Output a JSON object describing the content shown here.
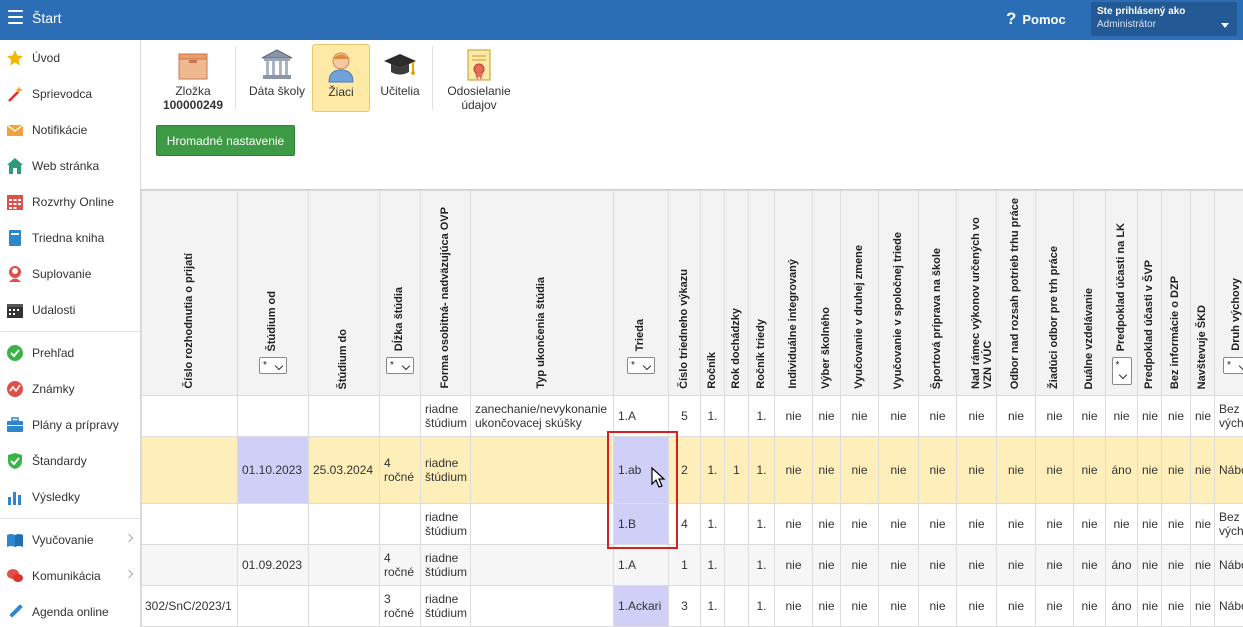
{
  "app": {
    "title": "Štart",
    "help": "Pomoc",
    "user_line1": "Ste prihlásený ako",
    "user_line2": "Administrátor"
  },
  "sidebar": {
    "items": [
      {
        "label": "Úvod",
        "icon": "star-icon"
      },
      {
        "label": "Sprievodca",
        "icon": "wand-icon"
      },
      {
        "label": "Notifikácie",
        "icon": "envelope-icon"
      },
      {
        "label": "Web stránka",
        "icon": "house-icon"
      },
      {
        "label": "Rozvrhy Online",
        "icon": "calendar-grid-icon"
      },
      {
        "label": "Triedna kniha",
        "icon": "book-icon"
      },
      {
        "label": "Suplovanie",
        "icon": "person-icon"
      },
      {
        "label": "Udalosti",
        "icon": "calendar-icon"
      },
      {
        "label": "Prehľad",
        "icon": "check-circle-icon"
      },
      {
        "label": "Známky",
        "icon": "graph-circle-icon"
      },
      {
        "label": "Plány a prípravy",
        "icon": "briefcase-icon"
      },
      {
        "label": "Štandardy",
        "icon": "shield-icon"
      },
      {
        "label": "Výsledky",
        "icon": "bar-chart-icon"
      },
      {
        "label": "Vyučovanie",
        "icon": "open-book-icon"
      },
      {
        "label": "Komunikácia",
        "icon": "chat-icon"
      },
      {
        "label": "Agenda online",
        "icon": "pencil-icon"
      }
    ]
  },
  "toolbar": {
    "folder_label": "Zložka",
    "folder_number": "100000249",
    "school_data": "Dáta školy",
    "students": "Žiaci",
    "teachers": "Učitelia",
    "send_line1": "Odosielanie",
    "send_line2": "údajov"
  },
  "bulk_button": "Hromadné nastavenie",
  "columns": [
    "Číslo rozhodnutia o prijatí",
    "Štúdium od",
    "Štúdium do",
    "Dĺžka štúdia",
    "Forma osobitná- nadväzujúca OVP",
    "Typ ukončenia štúdia",
    "Trieda",
    "Číslo triedneho výkazu",
    "Ročník",
    "Rok dochádzky",
    "Ročník triedy",
    "Individuálne integrovaný",
    "Výber školného",
    "Vyučovanie v druhej zmene",
    "Vyučovanie v spoločnej triede",
    "Športová príprava na škole",
    "Nad rámec výkonov určených vo VZN VÚC",
    "Odbor nad rozsah potrieb trhu práce",
    "Žiadúci odbor pre trh práce",
    "Duálne vzdelávanie",
    "Predpoklad účasti na LK",
    "Predpoklad účasti v ŠVP",
    "Bez informácie o DZP",
    "Navštevuje ŠKD",
    "Druh výchovy"
  ],
  "filter_value": "*",
  "rows": [
    [
      "",
      "",
      "",
      "",
      "riadne štúdium",
      "zanechanie/nevykonanie ukončovacej skúšky",
      "1.A",
      "5",
      "1.",
      "",
      "1.",
      "nie",
      "nie",
      "nie",
      "nie",
      "nie",
      "nie",
      "nie",
      "nie",
      "nie",
      "nie",
      "nie",
      "nie",
      "nie",
      "Bez výchovy"
    ],
    [
      "",
      "01.10.2023",
      "25.03.2024",
      "4 ročné",
      "riadne štúdium",
      "",
      "1.ab",
      "2",
      "1.",
      "1",
      "1.",
      "nie",
      "nie",
      "nie",
      "nie",
      "nie",
      "nie",
      "nie",
      "nie",
      "nie",
      "áno",
      "nie",
      "nie",
      "nie",
      "Nábože"
    ],
    [
      "",
      "",
      "",
      "",
      "riadne štúdium",
      "",
      "1.B",
      "4",
      "1.",
      "",
      "1.",
      "nie",
      "nie",
      "nie",
      "nie",
      "nie",
      "nie",
      "nie",
      "nie",
      "nie",
      "nie",
      "nie",
      "nie",
      "nie",
      "Bez výchovy"
    ],
    [
      "",
      "01.09.2023",
      "",
      "4 ročné",
      "riadne štúdium",
      "",
      "1.A",
      "1",
      "1.",
      "",
      "1.",
      "nie",
      "nie",
      "nie",
      "nie",
      "nie",
      "nie",
      "nie",
      "nie",
      "nie",
      "áno",
      "nie",
      "nie",
      "nie",
      "Nábože"
    ],
    [
      "302/SnC/2023/1",
      "",
      "",
      "3 ročné",
      "riadne štúdium",
      "",
      "1.Ackari",
      "3",
      "1.",
      "",
      "1.",
      "nie",
      "nie",
      "nie",
      "nie",
      "nie",
      "nie",
      "nie",
      "nie",
      "nie",
      "áno",
      "nie",
      "nie",
      "nie",
      "Nábože"
    ]
  ],
  "colors": {
    "topbar": "#2c6eb5",
    "highlight_row": "#fdeeba",
    "highlight_cell": "#cfcff7",
    "selection_box": "#d62020",
    "green_button": "#3e9b45"
  }
}
